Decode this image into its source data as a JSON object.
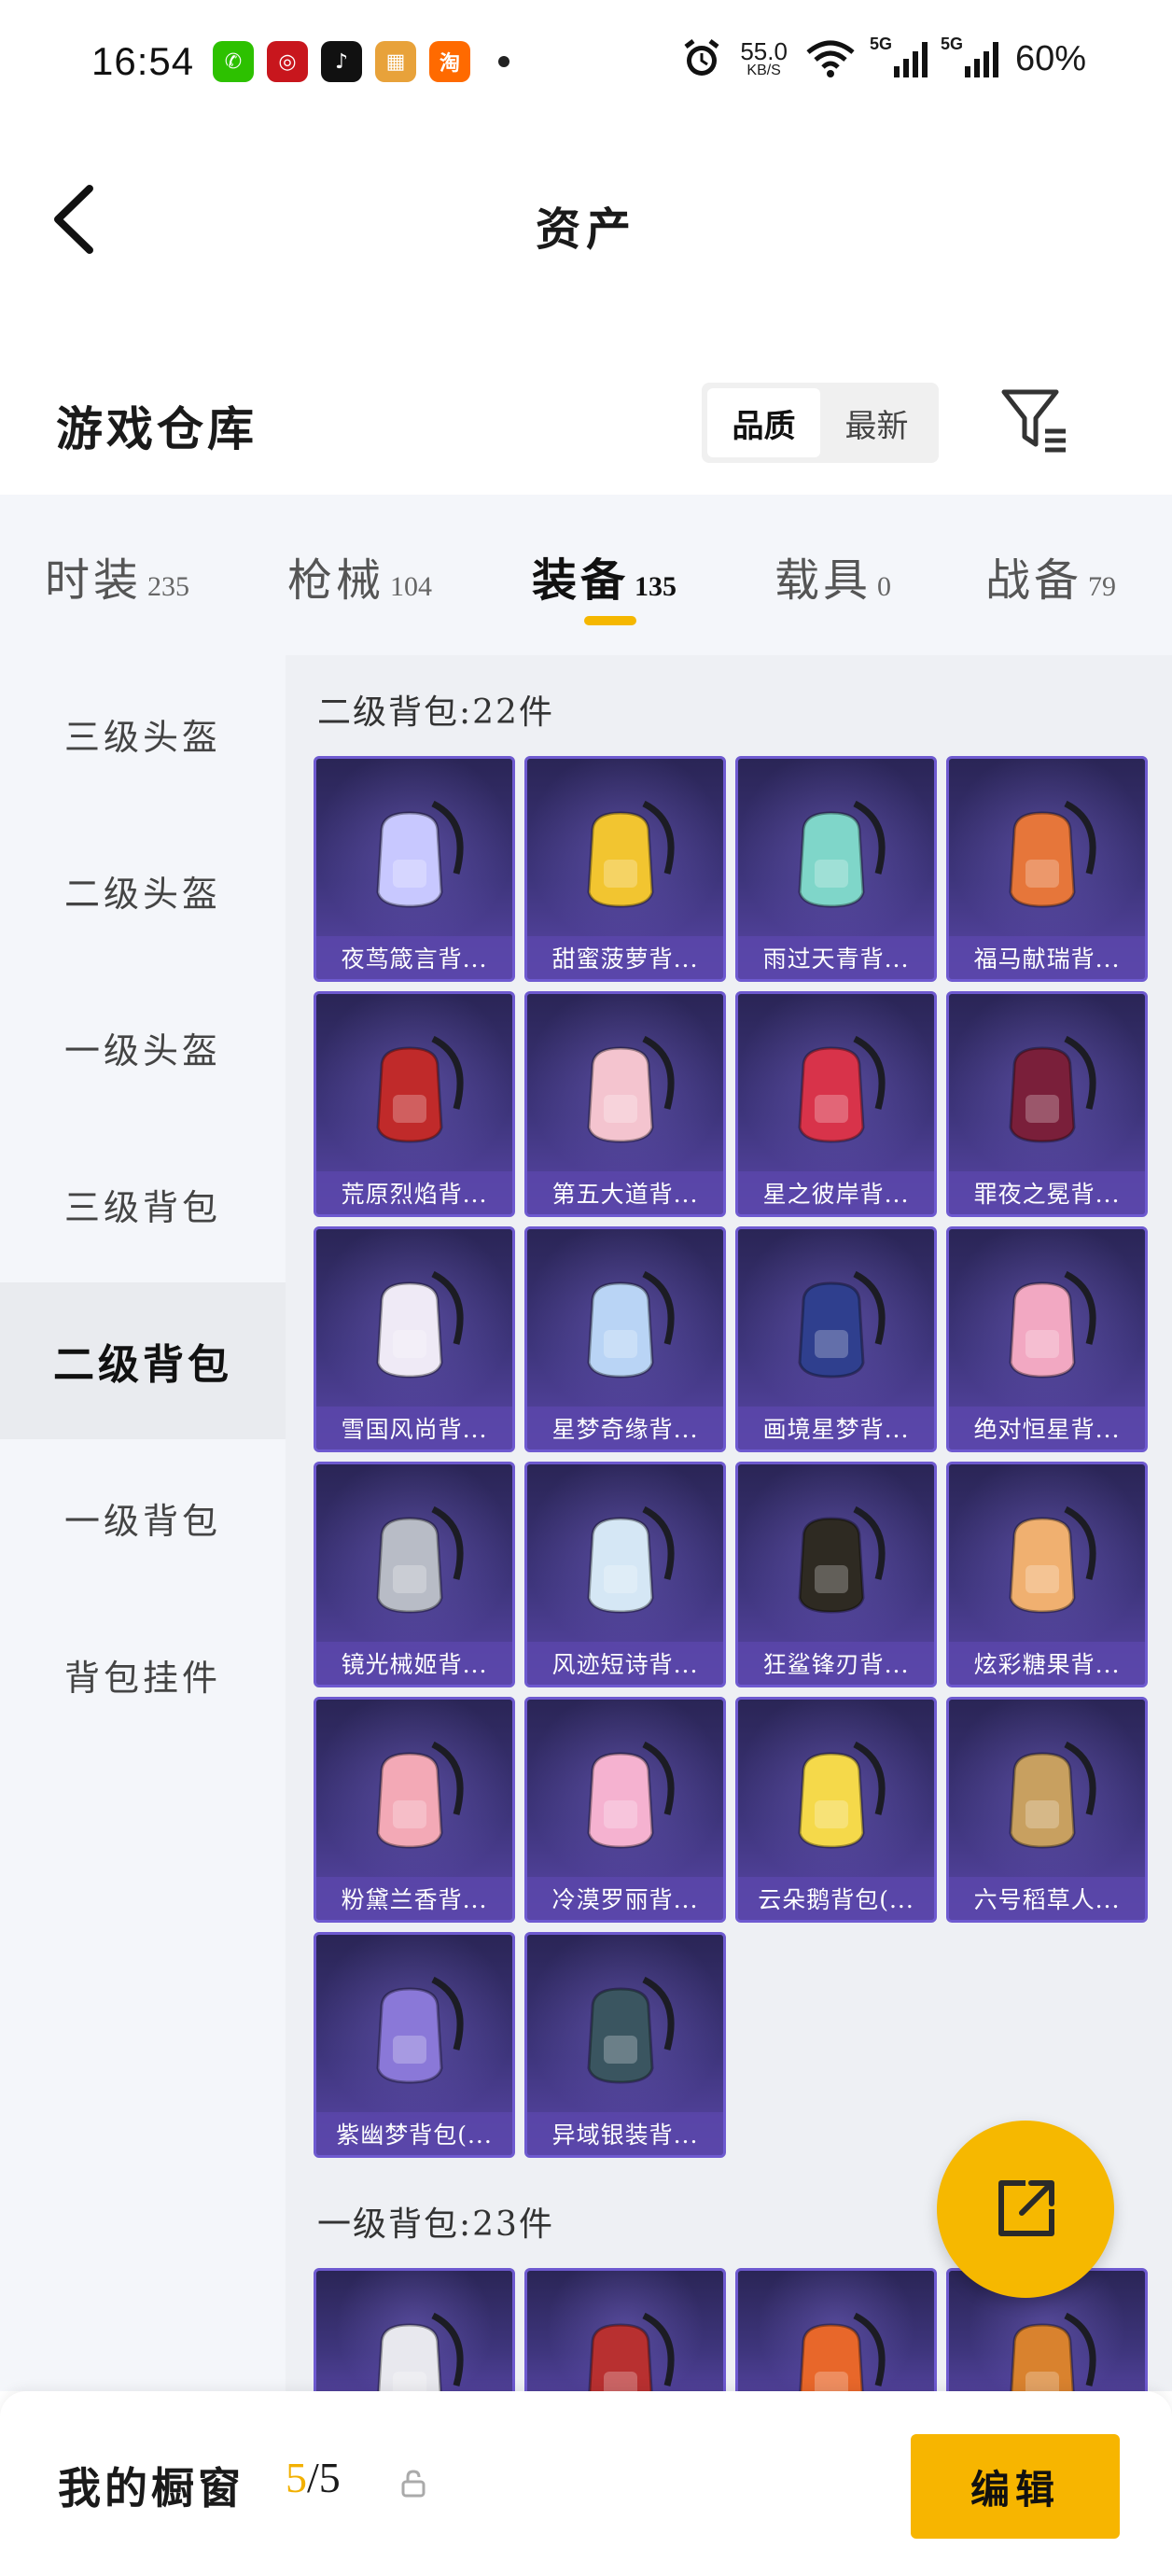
{
  "status_bar": {
    "time": "16:54",
    "net_speed": "55.0",
    "net_speed_unit": "KB/S",
    "sig1_tag": "5G",
    "sig2_tag": "5G",
    "battery": "60%",
    "apps": [
      "wechat-icon",
      "bank-icon",
      "tiktok-icon",
      "game-icon",
      "taobao-icon"
    ]
  },
  "header": {
    "title": "资产"
  },
  "warehouse": {
    "title": "游戏仓库",
    "sort_quality": "品质",
    "sort_latest": "最新"
  },
  "tabs": [
    {
      "label": "时装",
      "count": "235"
    },
    {
      "label": "枪械",
      "count": "104"
    },
    {
      "label": "装备",
      "count": "135"
    },
    {
      "label": "载具",
      "count": "0"
    },
    {
      "label": "战备",
      "count": "79"
    }
  ],
  "sidebar": [
    {
      "label": "三级头盔"
    },
    {
      "label": "二级头盔"
    },
    {
      "label": "一级头盔"
    },
    {
      "label": "三级背包"
    },
    {
      "label": "二级背包"
    },
    {
      "label": "一级背包"
    },
    {
      "label": "背包挂件"
    }
  ],
  "sections": [
    {
      "heading": "二级背包:22件",
      "items": [
        {
          "name": "夜茑箴言背...",
          "color": "#c8c8ff"
        },
        {
          "name": "甜蜜菠萝背...",
          "color": "#f2c530"
        },
        {
          "name": "雨过天青背...",
          "color": "#7fd6c9"
        },
        {
          "name": "福马献瑞背...",
          "color": "#e6763a"
        },
        {
          "name": "荒原烈焰背...",
          "color": "#c02a2a"
        },
        {
          "name": "第五大道背...",
          "color": "#f4c4cf"
        },
        {
          "name": "星之彼岸背...",
          "color": "#d8334a"
        },
        {
          "name": "罪夜之冕背...",
          "color": "#7a1f3a"
        },
        {
          "name": "雪国风尚背...",
          "color": "#efeaf6"
        },
        {
          "name": "星梦奇缘背...",
          "color": "#b9d4f5"
        },
        {
          "name": "画境星梦背...",
          "color": "#2f3f8e"
        },
        {
          "name": "绝对恒星背...",
          "color": "#f2a8c2"
        },
        {
          "name": "镜光械姬背...",
          "color": "#b8bcc6"
        },
        {
          "name": "风迹短诗背...",
          "color": "#d5e7f5"
        },
        {
          "name": "狂鲨锋刃背...",
          "color": "#2e2a22"
        },
        {
          "name": "炫彩糖果背...",
          "color": "#f0b070"
        },
        {
          "name": "粉黛兰香背...",
          "color": "#f3a9b6"
        },
        {
          "name": "冷漠罗丽背...",
          "color": "#f5b2d0"
        },
        {
          "name": "云朵鹅背包(...",
          "color": "#f5d94a"
        },
        {
          "name": "六号稻草人...",
          "color": "#c8a060"
        },
        {
          "name": "紫幽梦背包(...",
          "color": "#8a78d8"
        },
        {
          "name": "异域银装背...",
          "color": "#3a5560"
        }
      ]
    },
    {
      "heading": "一级背包:23件",
      "items": [
        {
          "name": "",
          "color": "#e8e8ee"
        },
        {
          "name": "",
          "color": "#b83030"
        },
        {
          "name": "",
          "color": "#e8672a"
        },
        {
          "name": "",
          "color": "#d9822e"
        }
      ]
    }
  ],
  "bottom_bar": {
    "label": "我的橱窗",
    "current": "5",
    "total": "/5",
    "edit_label": "编辑"
  },
  "colors": {
    "accent": "#f6b800",
    "card_bg": "#3e357c",
    "card_border": "#6e5ad0"
  }
}
